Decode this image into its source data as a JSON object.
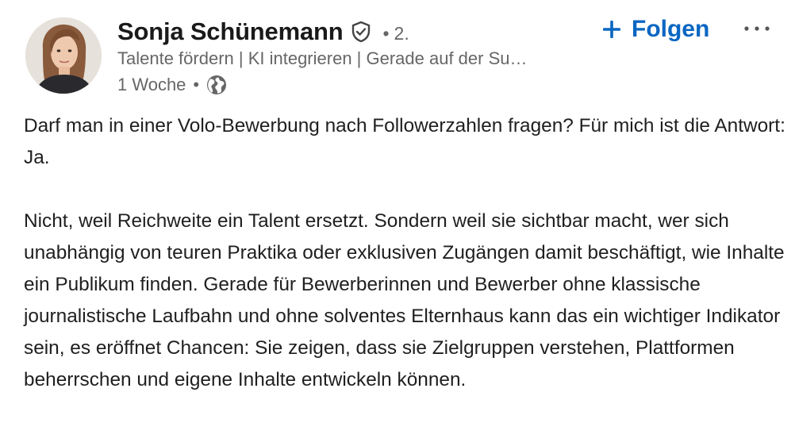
{
  "author": {
    "name": "Sonja Schünemann",
    "degree_dot": "•",
    "degree": "2.",
    "headline": "Talente fördern | KI integrieren | Gerade auf der Su…",
    "time": "1 Woche",
    "meta_dot": "•",
    "avatar_icon": "profile-photo",
    "verified_icon": "verified-shield-icon",
    "visibility_icon": "globe-icon"
  },
  "actions": {
    "follow_label": "Folgen",
    "follow_icon": "plus-icon",
    "more_icon": "ellipsis-icon",
    "accent_color": "#0a66c2"
  },
  "post": {
    "paragraphs": [
      "Darf man in einer Volo-Bewerbung nach Followerzahlen fragen? Für mich ist die Antwort: Ja.",
      "Nicht, weil Reichweite ein Talent ersetzt. Sondern weil sie sichtbar macht, wer sich unabhängig von teuren Praktika oder exklusiven Zugängen damit beschäftigt, wie Inhalte ein Publikum finden. Gerade für Bewerberinnen und Bewerber ohne klassische journalistische Laufbahn und ohne solventes Elternhaus kann das ein wichtiger Indikator sein, es eröffnet Chancen: Sie zeigen, dass sie Zielgruppen verstehen, Plattformen beherrschen und eigene Inhalte entwickeln können."
    ]
  }
}
